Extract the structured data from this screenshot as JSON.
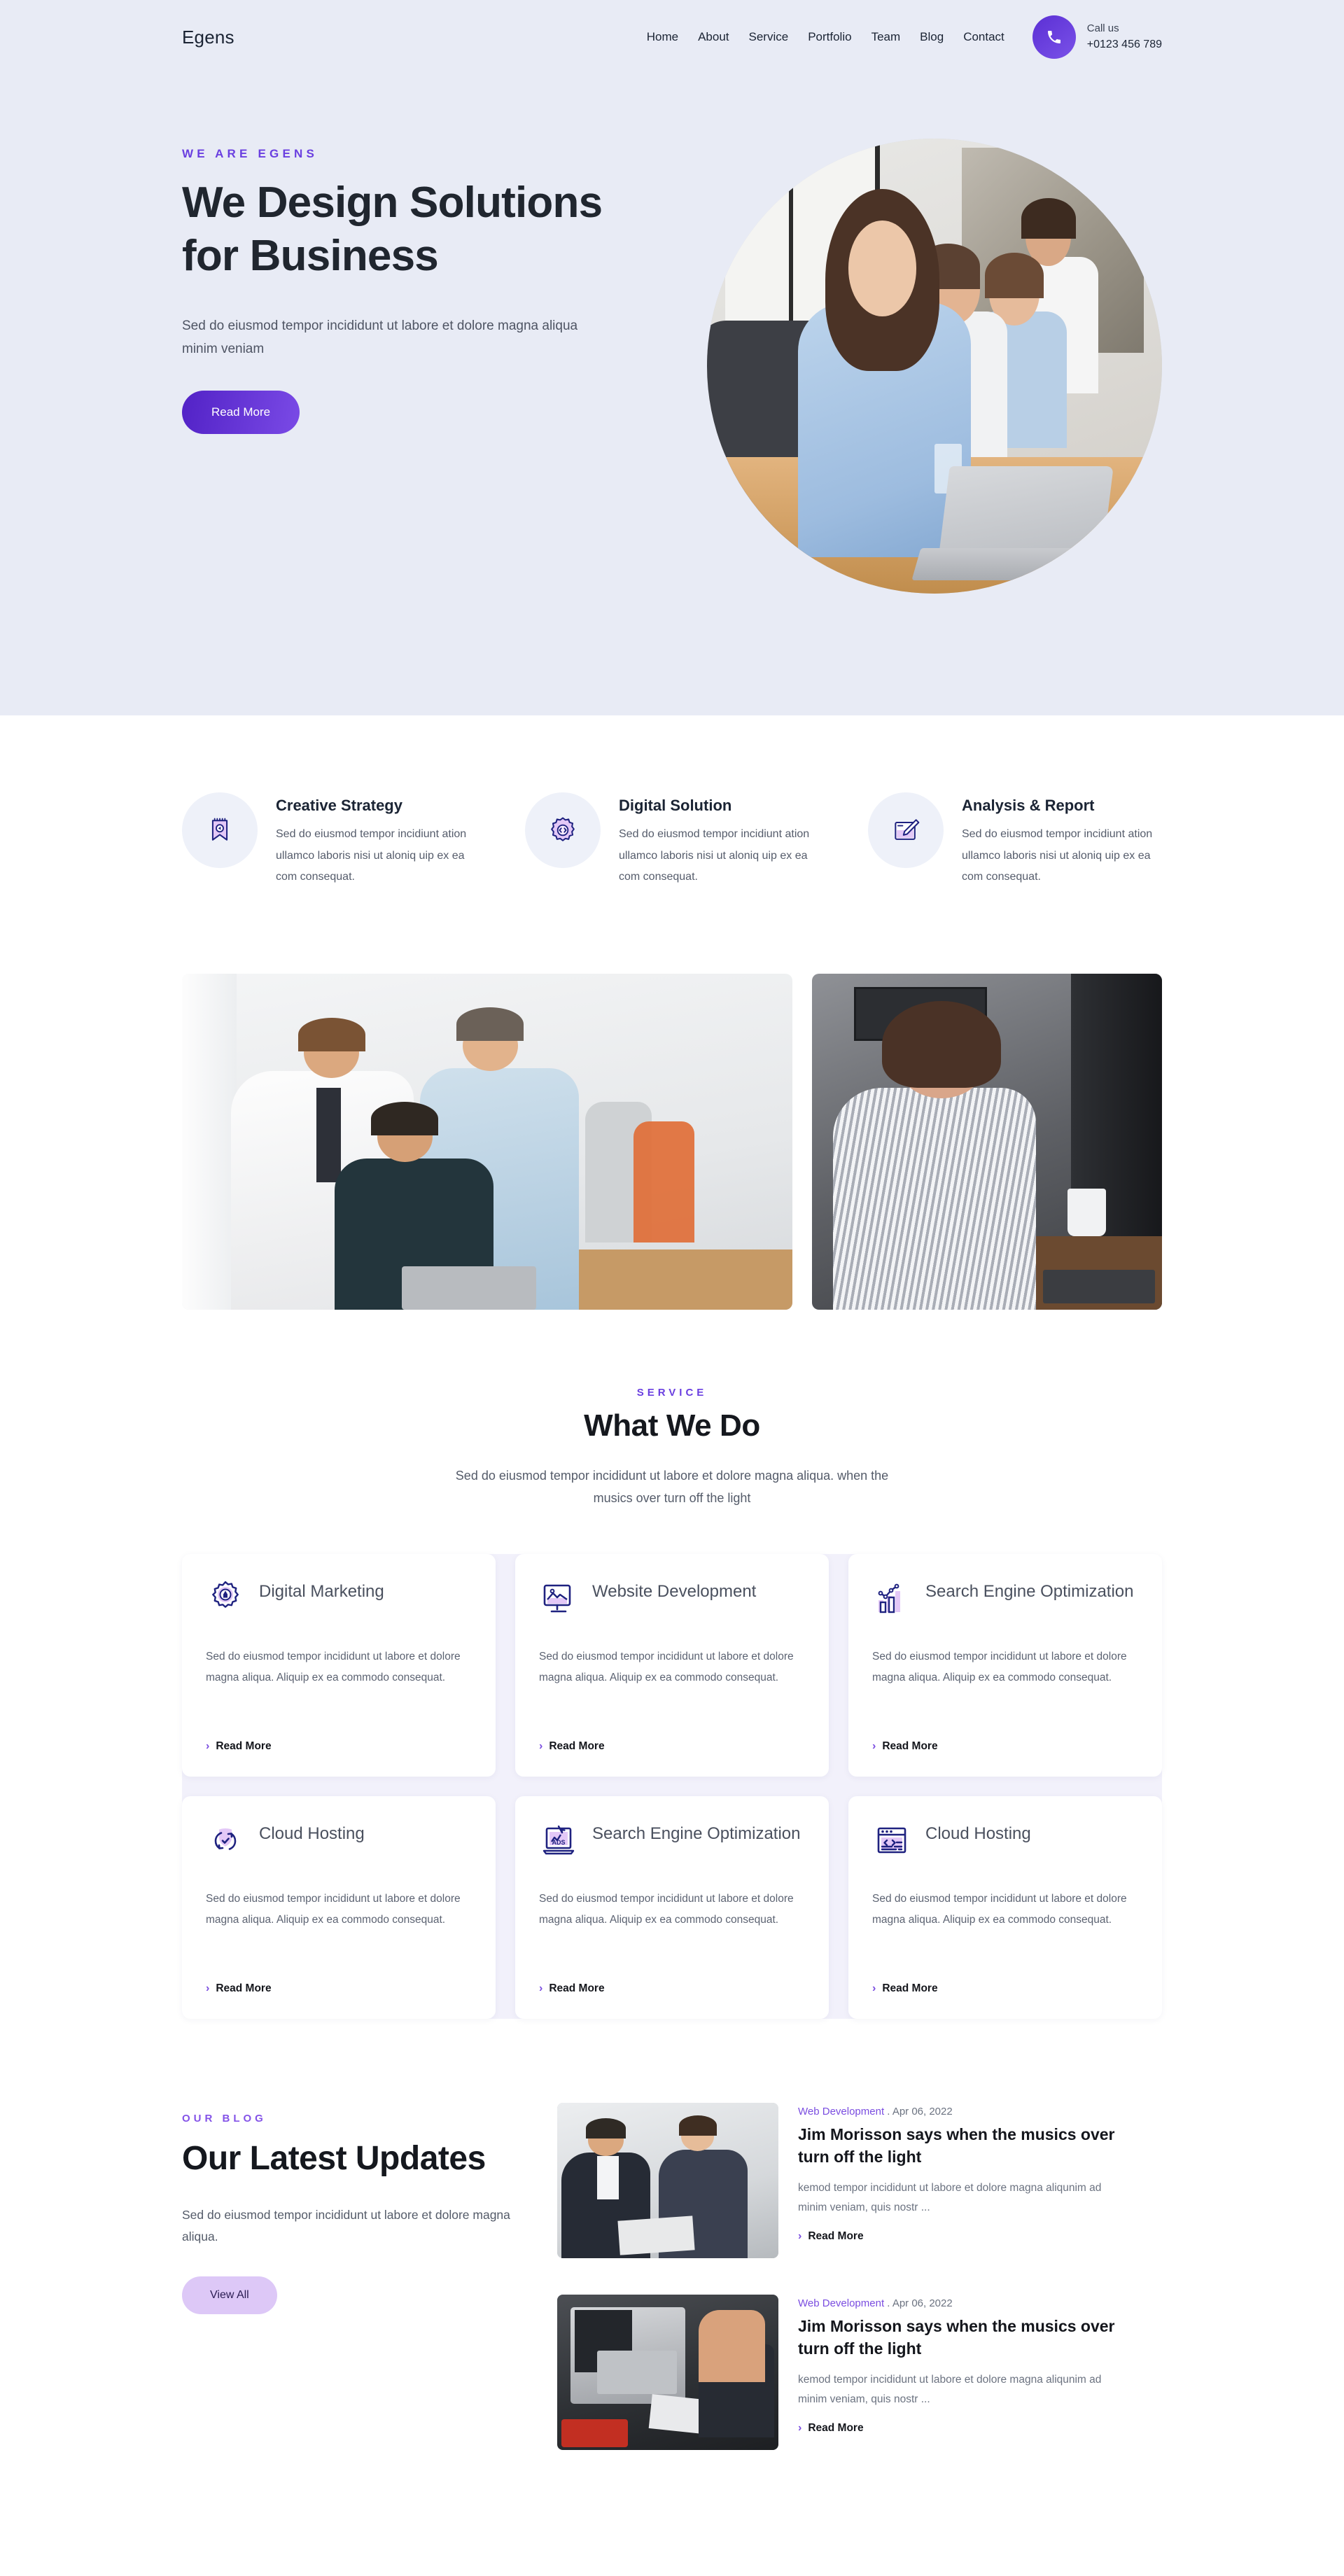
{
  "header": {
    "logo": "Egens",
    "nav": [
      {
        "label": "Home",
        "active": true
      },
      {
        "label": "About",
        "active": false
      },
      {
        "label": "Service",
        "active": false
      },
      {
        "label": "Portfolio",
        "active": false
      },
      {
        "label": "Team",
        "active": false
      },
      {
        "label": "Blog",
        "active": false
      },
      {
        "label": "Contact",
        "active": false
      }
    ],
    "call": {
      "icon": "phone-icon",
      "label": "Call us",
      "number": "+0123 456 789"
    }
  },
  "hero": {
    "eyebrow": "WE ARE EGENS",
    "title": "We Design Solutions for Business",
    "subtitle": "Sed do eiusmod tempor incididunt ut labore et dolore magna aliqua minim veniam",
    "cta": "Read More",
    "image_alt": "team-meeting-photo"
  },
  "features": [
    {
      "icon": "ribbon-megaphone-icon",
      "title": "Creative Strategy",
      "desc": "Sed do eiusmod tempor incidiunt ation ullamco laboris nisi ut aloniq uip ex ea com consequat."
    },
    {
      "icon": "gear-code-icon",
      "title": "Digital Solution",
      "desc": "Sed do eiusmod tempor incidiunt ation ullamco laboris nisi ut aloniq uip ex ea com consequat."
    },
    {
      "icon": "pencil-board-icon",
      "title": "Analysis & Report",
      "desc": "Sed do eiusmod tempor incidiunt ation ullamco laboris nisi ut aloniq uip ex ea com consequat."
    }
  ],
  "gallery": {
    "left_alt": "team-group-photo",
    "right_alt": "woman-on-phone-photo"
  },
  "service": {
    "eyebrow": "SERVICE",
    "title": "What We Do",
    "subtitle": "Sed do eiusmod tempor incididunt ut labore et dolore magna aliqua. when the musics over turn off the light",
    "cards": [
      {
        "icon": "gear-pen-icon",
        "name": "Digital Marketing",
        "desc": "Sed do eiusmod tempor incididunt ut labore et dolore magna aliqua. Aliquip ex ea commodo consequat.",
        "link": "Read More"
      },
      {
        "icon": "monitor-image-icon",
        "name": "Website Development",
        "desc": "Sed do eiusmod tempor incididunt ut labore et dolore magna aliqua. Aliquip ex ea commodo consequat.",
        "link": "Read More"
      },
      {
        "icon": "bar-chart-growth-icon",
        "name": "Search Engine Optimization",
        "desc": "Sed do eiusmod tempor incididunt ut labore et dolore magna aliqua. Aliquip ex ea commodo consequat.",
        "link": "Read More"
      },
      {
        "icon": "shield-check-cycle-icon",
        "name": "Cloud Hosting",
        "desc": "Sed do eiusmod tempor incididunt ut labore et dolore magna aliqua. Aliquip ex ea commodo consequat.",
        "link": "Read More"
      },
      {
        "icon": "laptop-ads-icon",
        "name": "Search Engine Optimization",
        "desc": "Sed do eiusmod tempor incididunt ut labore et dolore magna aliqua. Aliquip ex ea commodo consequat.",
        "link": "Read More"
      },
      {
        "icon": "browser-code-icon",
        "name": "Cloud Hosting",
        "desc": "Sed do eiusmod tempor incididunt ut labore et dolore magna aliqua. Aliquip ex ea commodo consequat.",
        "link": "Read More"
      }
    ]
  },
  "blog": {
    "eyebrow": "OUR BLOG",
    "title": "Our Latest Updates",
    "subtitle": "Sed do eiusmod tempor incididunt ut labore et dolore magna aliqua.",
    "cta": "View All",
    "posts": [
      {
        "thumb_alt": "two-men-reviewing-documents-photo",
        "category": "Web Development",
        "separator": ".",
        "date": "Apr 06, 2022",
        "title": "Jim Morisson says when the musics over turn off the light",
        "excerpt": "kemod tempor incididunt ut labore et dolore magna aliqunim ad minim veniam, quis nostr ...",
        "link": "Read More"
      },
      {
        "thumb_alt": "laptop-hands-workspace-photo",
        "category": "Web Development",
        "separator": ".",
        "date": "Apr 06, 2022",
        "title": "Jim Morisson says when the musics over turn off the light",
        "excerpt": "kemod tempor incididunt ut labore et dolore magna aliqunim ad minim veniam, quis nostr ...",
        "link": "Read More"
      }
    ]
  },
  "colors": {
    "accent": "#6a3fe0",
    "accent_deep": "#5222c6",
    "hero_bg": "#e8ebf5",
    "icon_navy": "#1f2280",
    "icon_lilac": "#e3c8f7",
    "soft_button": "#ddc8f7",
    "service_panel": "#f2f1fb"
  }
}
